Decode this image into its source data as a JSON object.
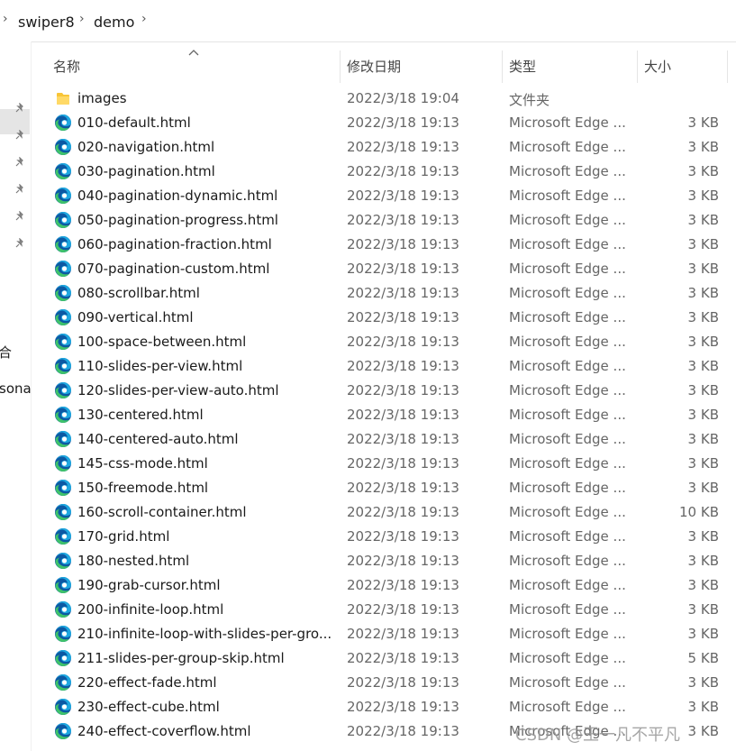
{
  "breadcrumb": {
    "items": [
      "swiper8",
      "demo"
    ]
  },
  "nav_fragments": {
    "frag1": "合",
    "frag2": "sona"
  },
  "columns": {
    "name": "名称",
    "date": "修改日期",
    "type": "类型",
    "size": "大小"
  },
  "files": [
    {
      "icon": "folder-icon",
      "name": "images",
      "date": "2022/3/18 19:04",
      "type": "文件夹",
      "size": ""
    },
    {
      "icon": "edge-icon",
      "name": "010-default.html",
      "date": "2022/3/18 19:13",
      "type": "Microsoft Edge ...",
      "size": "3 KB"
    },
    {
      "icon": "edge-icon",
      "name": "020-navigation.html",
      "date": "2022/3/18 19:13",
      "type": "Microsoft Edge ...",
      "size": "3 KB"
    },
    {
      "icon": "edge-icon",
      "name": "030-pagination.html",
      "date": "2022/3/18 19:13",
      "type": "Microsoft Edge ...",
      "size": "3 KB"
    },
    {
      "icon": "edge-icon",
      "name": "040-pagination-dynamic.html",
      "date": "2022/3/18 19:13",
      "type": "Microsoft Edge ...",
      "size": "3 KB"
    },
    {
      "icon": "edge-icon",
      "name": "050-pagination-progress.html",
      "date": "2022/3/18 19:13",
      "type": "Microsoft Edge ...",
      "size": "3 KB"
    },
    {
      "icon": "edge-icon",
      "name": "060-pagination-fraction.html",
      "date": "2022/3/18 19:13",
      "type": "Microsoft Edge ...",
      "size": "3 KB"
    },
    {
      "icon": "edge-icon",
      "name": "070-pagination-custom.html",
      "date": "2022/3/18 19:13",
      "type": "Microsoft Edge ...",
      "size": "3 KB"
    },
    {
      "icon": "edge-icon",
      "name": "080-scrollbar.html",
      "date": "2022/3/18 19:13",
      "type": "Microsoft Edge ...",
      "size": "3 KB"
    },
    {
      "icon": "edge-icon",
      "name": "090-vertical.html",
      "date": "2022/3/18 19:13",
      "type": "Microsoft Edge ...",
      "size": "3 KB"
    },
    {
      "icon": "edge-icon",
      "name": "100-space-between.html",
      "date": "2022/3/18 19:13",
      "type": "Microsoft Edge ...",
      "size": "3 KB"
    },
    {
      "icon": "edge-icon",
      "name": "110-slides-per-view.html",
      "date": "2022/3/18 19:13",
      "type": "Microsoft Edge ...",
      "size": "3 KB"
    },
    {
      "icon": "edge-icon",
      "name": "120-slides-per-view-auto.html",
      "date": "2022/3/18 19:13",
      "type": "Microsoft Edge ...",
      "size": "3 KB"
    },
    {
      "icon": "edge-icon",
      "name": "130-centered.html",
      "date": "2022/3/18 19:13",
      "type": "Microsoft Edge ...",
      "size": "3 KB"
    },
    {
      "icon": "edge-icon",
      "name": "140-centered-auto.html",
      "date": "2022/3/18 19:13",
      "type": "Microsoft Edge ...",
      "size": "3 KB"
    },
    {
      "icon": "edge-icon",
      "name": "145-css-mode.html",
      "date": "2022/3/18 19:13",
      "type": "Microsoft Edge ...",
      "size": "3 KB"
    },
    {
      "icon": "edge-icon",
      "name": "150-freemode.html",
      "date": "2022/3/18 19:13",
      "type": "Microsoft Edge ...",
      "size": "3 KB"
    },
    {
      "icon": "edge-icon",
      "name": "160-scroll-container.html",
      "date": "2022/3/18 19:13",
      "type": "Microsoft Edge ...",
      "size": "10 KB"
    },
    {
      "icon": "edge-icon",
      "name": "170-grid.html",
      "date": "2022/3/18 19:13",
      "type": "Microsoft Edge ...",
      "size": "3 KB"
    },
    {
      "icon": "edge-icon",
      "name": "180-nested.html",
      "date": "2022/3/18 19:13",
      "type": "Microsoft Edge ...",
      "size": "3 KB"
    },
    {
      "icon": "edge-icon",
      "name": "190-grab-cursor.html",
      "date": "2022/3/18 19:13",
      "type": "Microsoft Edge ...",
      "size": "3 KB"
    },
    {
      "icon": "edge-icon",
      "name": "200-infinite-loop.html",
      "date": "2022/3/18 19:13",
      "type": "Microsoft Edge ...",
      "size": "3 KB"
    },
    {
      "icon": "edge-icon",
      "name": "210-infinite-loop-with-slides-per-gro...",
      "date": "2022/3/18 19:13",
      "type": "Microsoft Edge ...",
      "size": "3 KB"
    },
    {
      "icon": "edge-icon",
      "name": "211-slides-per-group-skip.html",
      "date": "2022/3/18 19:13",
      "type": "Microsoft Edge ...",
      "size": "5 KB"
    },
    {
      "icon": "edge-icon",
      "name": "220-effect-fade.html",
      "date": "2022/3/18 19:13",
      "type": "Microsoft Edge ...",
      "size": "3 KB"
    },
    {
      "icon": "edge-icon",
      "name": "230-effect-cube.html",
      "date": "2022/3/18 19:13",
      "type": "Microsoft Edge ...",
      "size": "3 KB"
    },
    {
      "icon": "edge-icon",
      "name": "240-effect-coverflow.html",
      "date": "2022/3/18 19:13",
      "type": "Microsoft Edge ...",
      "size": "3 KB"
    }
  ],
  "watermark": "CSDN @王一凡不平凡",
  "colors": {
    "folder": "#f8c537",
    "edge_blue": "#0c59a4",
    "edge_green": "#3fc36a",
    "edge_cyan": "#1ea8e0"
  }
}
